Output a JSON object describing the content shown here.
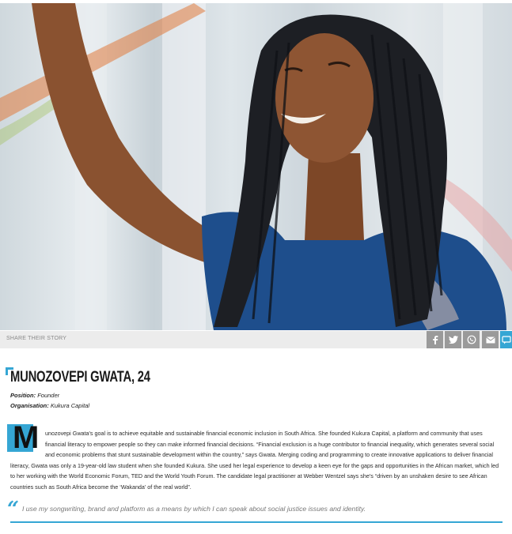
{
  "share": {
    "label": "SHARE THEIR STORY",
    "buttons": [
      {
        "name": "facebook-icon",
        "color": "#9a9a9a"
      },
      {
        "name": "twitter-icon",
        "color": "#9a9a9a"
      },
      {
        "name": "whatsapp-icon",
        "color": "#9a9a9a"
      },
      {
        "name": "email-icon",
        "color": "#9a9a9a"
      },
      {
        "name": "comment-icon",
        "color": "#35a6d4"
      }
    ]
  },
  "profile": {
    "name": "MUNOZOVEPI GWATA, 24",
    "position_label": "Position:",
    "position_value": "Founder",
    "organisation_label": "Organisation:",
    "organisation_value": "Kukura Capital"
  },
  "article": {
    "dropcap": "M",
    "body": "unozovepi Gwata's goal is to achieve equitable and sustainable financial economic inclusion in South Africa. She founded Kukura Capital, a platform and community that uses financial literacy to empower people so they can make informed financial decisions. “Financial exclusion is a huge contributor to financial inequality, which generates several social and economic problems that stunt sustainable development within the country,” says Gwata. Merging coding and programming to create innovative applications to deliver financial literacy, Gwata was only a 19-year-old law student when she founded Kukura. She used her legal experience to develop a keen eye for the gaps and opportunities in the African market, which led to her working with the World Economic Forum, TED and the World Youth Forum. The candidate legal practitioner at Webber Wentzel says she's “driven by an unshaken desire to see African countries such as South Africa become the ‘Wakanda’ of the real world”.",
    "quote": "I use my songwriting, brand and platform as a means by which I can speak about social justice issues and identity."
  },
  "colors": {
    "accent": "#35a6d4",
    "share_bar": "#ececec",
    "share_button": "#9a9a9a"
  }
}
